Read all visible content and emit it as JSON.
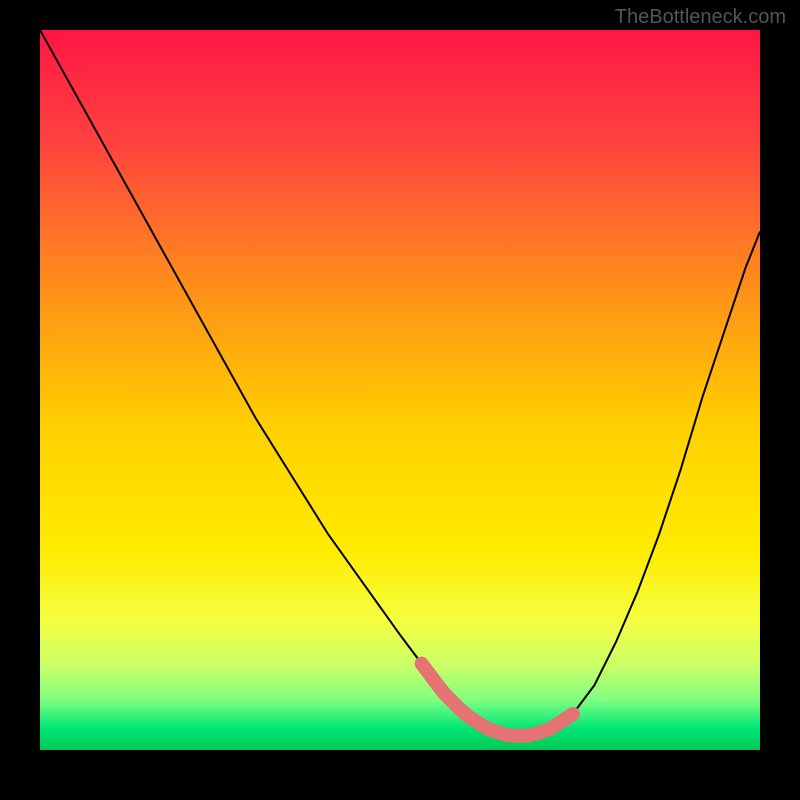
{
  "watermark": "TheBottleneck.com",
  "chart_data": {
    "type": "line",
    "title": "",
    "xlabel": "",
    "ylabel": "",
    "xlim": [
      0,
      100
    ],
    "ylim": [
      0,
      100
    ],
    "background_gradient_stops": [
      {
        "offset": 0,
        "color": "#ff1744"
      },
      {
        "offset": 15,
        "color": "#ff4040"
      },
      {
        "offset": 35,
        "color": "#ff8c1a"
      },
      {
        "offset": 55,
        "color": "#ffd000"
      },
      {
        "offset": 72,
        "color": "#ffeb00"
      },
      {
        "offset": 82,
        "color": "#f5ff40"
      },
      {
        "offset": 88,
        "color": "#ccff66"
      },
      {
        "offset": 93,
        "color": "#80ff80"
      },
      {
        "offset": 97,
        "color": "#00e676"
      },
      {
        "offset": 100,
        "color": "#00c853"
      }
    ],
    "series": [
      {
        "name": "bottleneck-curve",
        "color": "#000000",
        "x": [
          0,
          5,
          10,
          15,
          20,
          25,
          30,
          35,
          40,
          45,
          50,
          53,
          56,
          59,
          62,
          65,
          68,
          71,
          74,
          77,
          80,
          83,
          86,
          89,
          92,
          95,
          98,
          100
        ],
        "y": [
          100,
          91,
          82,
          73,
          64,
          55,
          46,
          38,
          30,
          23,
          16,
          12,
          8,
          5,
          3,
          2,
          2,
          3,
          5,
          9,
          15,
          22,
          30,
          39,
          49,
          58,
          67,
          72
        ]
      }
    ],
    "highlight_region": {
      "name": "optimal-range",
      "color": "#e57373",
      "x_start": 53,
      "x_end": 74,
      "y_level": 4,
      "thickness": 3
    }
  }
}
